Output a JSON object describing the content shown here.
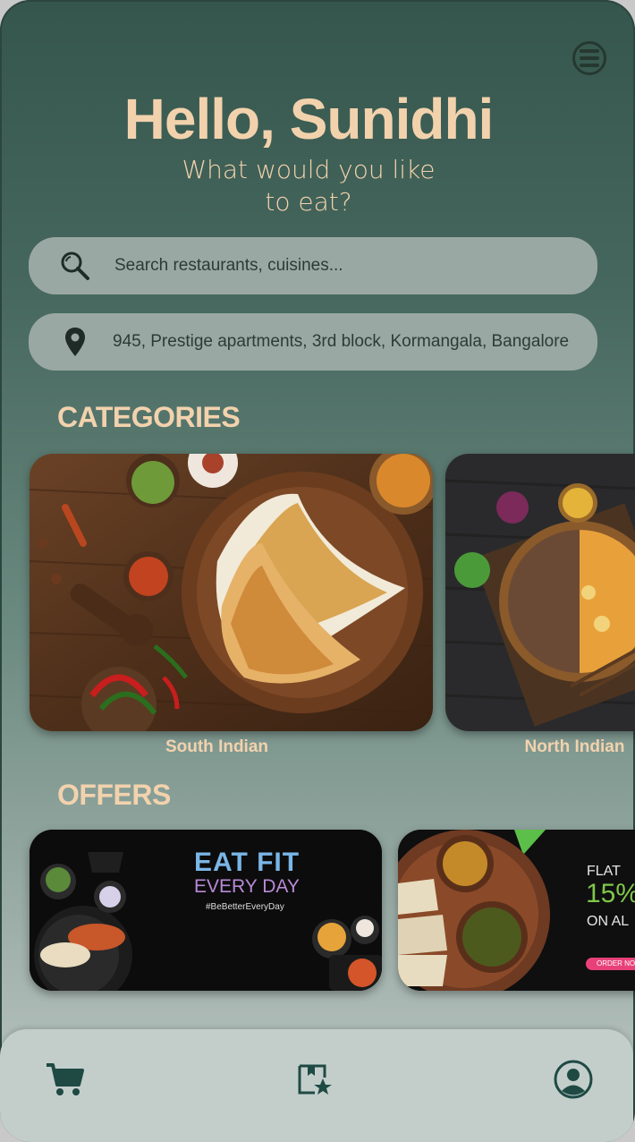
{
  "header": {
    "greeting": "Hello, Sunidhi",
    "subtitle": "What would you like to eat?"
  },
  "search": {
    "placeholder": "Search restaurants, cuisines..."
  },
  "location": {
    "address": "945, Prestige apartments, 3rd block, Kormangala, Bangalore"
  },
  "categories": {
    "title": "CATEGORIES",
    "items": [
      {
        "label": "South Indian"
      },
      {
        "label": "North Indian"
      }
    ]
  },
  "offers": {
    "title": "OFFERS",
    "items": [
      {
        "headline_1": "EAT FIT",
        "headline_2": "EVERY DAY",
        "hashtag": "#BeBetterEveryDay"
      },
      {
        "line1": "FLAT",
        "line2": "15%",
        "line3": "ON AL",
        "cta": "ORDER NO"
      }
    ]
  },
  "icons": {
    "menu": "menu-icon",
    "search": "search-icon",
    "location": "location-pin-icon",
    "cart": "cart-icon",
    "saved": "bookmark-star-icon",
    "profile": "profile-icon"
  },
  "colors": {
    "accent_text": "#f2d2ad",
    "background_top": "#35564c",
    "field_bg": "#9aa8a3",
    "nav_bg": "#c3cecb",
    "icon_dark": "#25382f"
  }
}
